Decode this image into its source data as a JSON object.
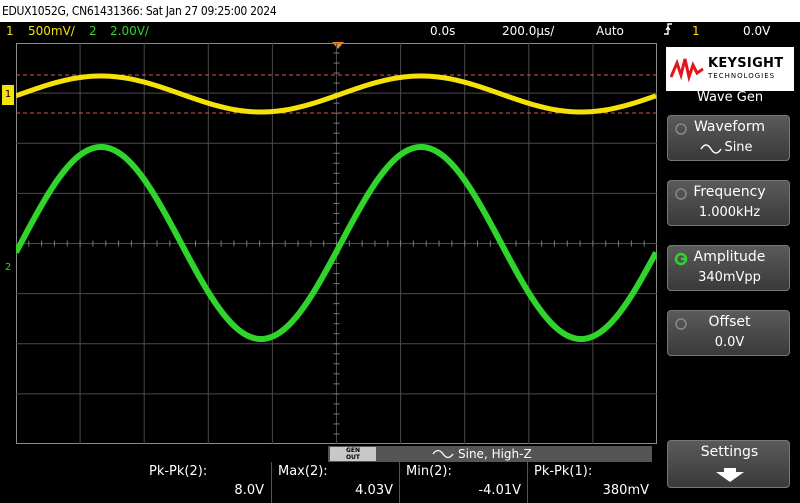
{
  "titlebar": {
    "text": "EDUX1052G, CN61431366: Sat Jan 27 09:25:00 2024"
  },
  "status": {
    "ch1_num": "1",
    "ch1_scale": "500mV/",
    "ch2_num": "2",
    "ch2_scale": "2.00V/",
    "time_offset": "0.0s",
    "timebase": "200.0µs/",
    "trigger_mode": "Auto",
    "trigger_icon": "trigger-edge-icon",
    "trigger_src": "1",
    "trigger_level": "0.0V"
  },
  "channels": {
    "ch1_marker": "1",
    "ch2_marker": "2",
    "ch1_color": "#f4e20a",
    "ch2_color": "#2fd42c"
  },
  "sidepanel": {
    "brand": "KEYSIGHT",
    "brand_sub": "TECHNOLOGIES",
    "title": "Wave Gen",
    "waveform_label": "Waveform",
    "waveform_value": "Sine",
    "frequency_label": "Frequency",
    "frequency_value": "1.000kHz",
    "amplitude_label": "Amplitude",
    "amplitude_value": "340mVpp",
    "offset_label": "Offset",
    "offset_value": "0.0V",
    "settings_label": "Settings"
  },
  "genbar": {
    "gen_label_line1": "GEN",
    "gen_label_line2": "OUT",
    "text": "Sine, High-Z"
  },
  "measurements": [
    {
      "label": "Pk-Pk(2):",
      "value": "8.0V"
    },
    {
      "label": "Max(2):",
      "value": "4.03V"
    },
    {
      "label": "Min(2):",
      "value": "-4.01V"
    },
    {
      "label": "Pk-Pk(1):",
      "value": "380mV"
    }
  ]
}
